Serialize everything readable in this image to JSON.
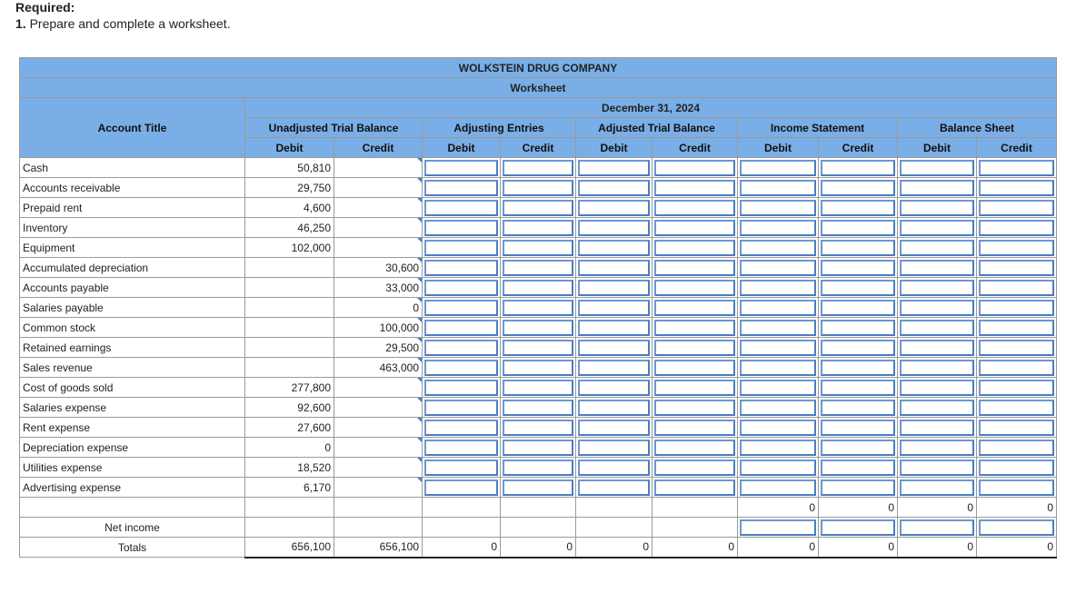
{
  "required_label": "Required:",
  "instruction_num": "1.",
  "instruction_text": "Prepare and complete a worksheet.",
  "company": "WOLKSTEIN DRUG COMPANY",
  "sheet_name": "Worksheet",
  "date": "December 31, 2024",
  "headers": {
    "account_title": "Account Title",
    "unadjusted": "Unadjusted Trial Balance",
    "adjusting": "Adjusting Entries",
    "adjusted": "Adjusted Trial Balance",
    "income": "Income Statement",
    "balance": "Balance Sheet",
    "debit": "Debit",
    "credit": "Credit"
  },
  "rows": [
    {
      "account": "Cash",
      "debit": "50,810",
      "credit": ""
    },
    {
      "account": "Accounts receivable",
      "debit": "29,750",
      "credit": ""
    },
    {
      "account": "Prepaid rent",
      "debit": "4,600",
      "credit": ""
    },
    {
      "account": "Inventory",
      "debit": "46,250",
      "credit": ""
    },
    {
      "account": "Equipment",
      "debit": "102,000",
      "credit": ""
    },
    {
      "account": "Accumulated depreciation",
      "debit": "",
      "credit": "30,600"
    },
    {
      "account": "Accounts payable",
      "debit": "",
      "credit": "33,000"
    },
    {
      "account": "Salaries payable",
      "debit": "",
      "credit": "0"
    },
    {
      "account": "Common stock",
      "debit": "",
      "credit": "100,000"
    },
    {
      "account": "Retained earnings",
      "debit": "",
      "credit": "29,500"
    },
    {
      "account": "Sales revenue",
      "debit": "",
      "credit": "463,000"
    },
    {
      "account": "Cost of goods sold",
      "debit": "277,800",
      "credit": ""
    },
    {
      "account": "Salaries expense",
      "debit": "92,600",
      "credit": ""
    },
    {
      "account": "Rent expense",
      "debit": "27,600",
      "credit": ""
    },
    {
      "account": "Depreciation expense",
      "debit": "0",
      "credit": ""
    },
    {
      "account": "Utilities expense",
      "debit": "18,520",
      "credit": ""
    },
    {
      "account": "Advertising expense",
      "debit": "6,170",
      "credit": ""
    }
  ],
  "subtotals": {
    "income_debit": "0",
    "income_credit": "0",
    "balance_debit": "0",
    "balance_credit": "0"
  },
  "net_income_label": "Net income",
  "totals_label": "Totals",
  "totals": {
    "unadj_debit": "656,100",
    "unadj_credit": "656,100",
    "adj_debit": "0",
    "adj_credit": "0",
    "atb_debit": "0",
    "atb_credit": "0",
    "inc_debit": "0",
    "inc_credit": "0",
    "bal_debit": "0",
    "bal_credit": "0"
  }
}
